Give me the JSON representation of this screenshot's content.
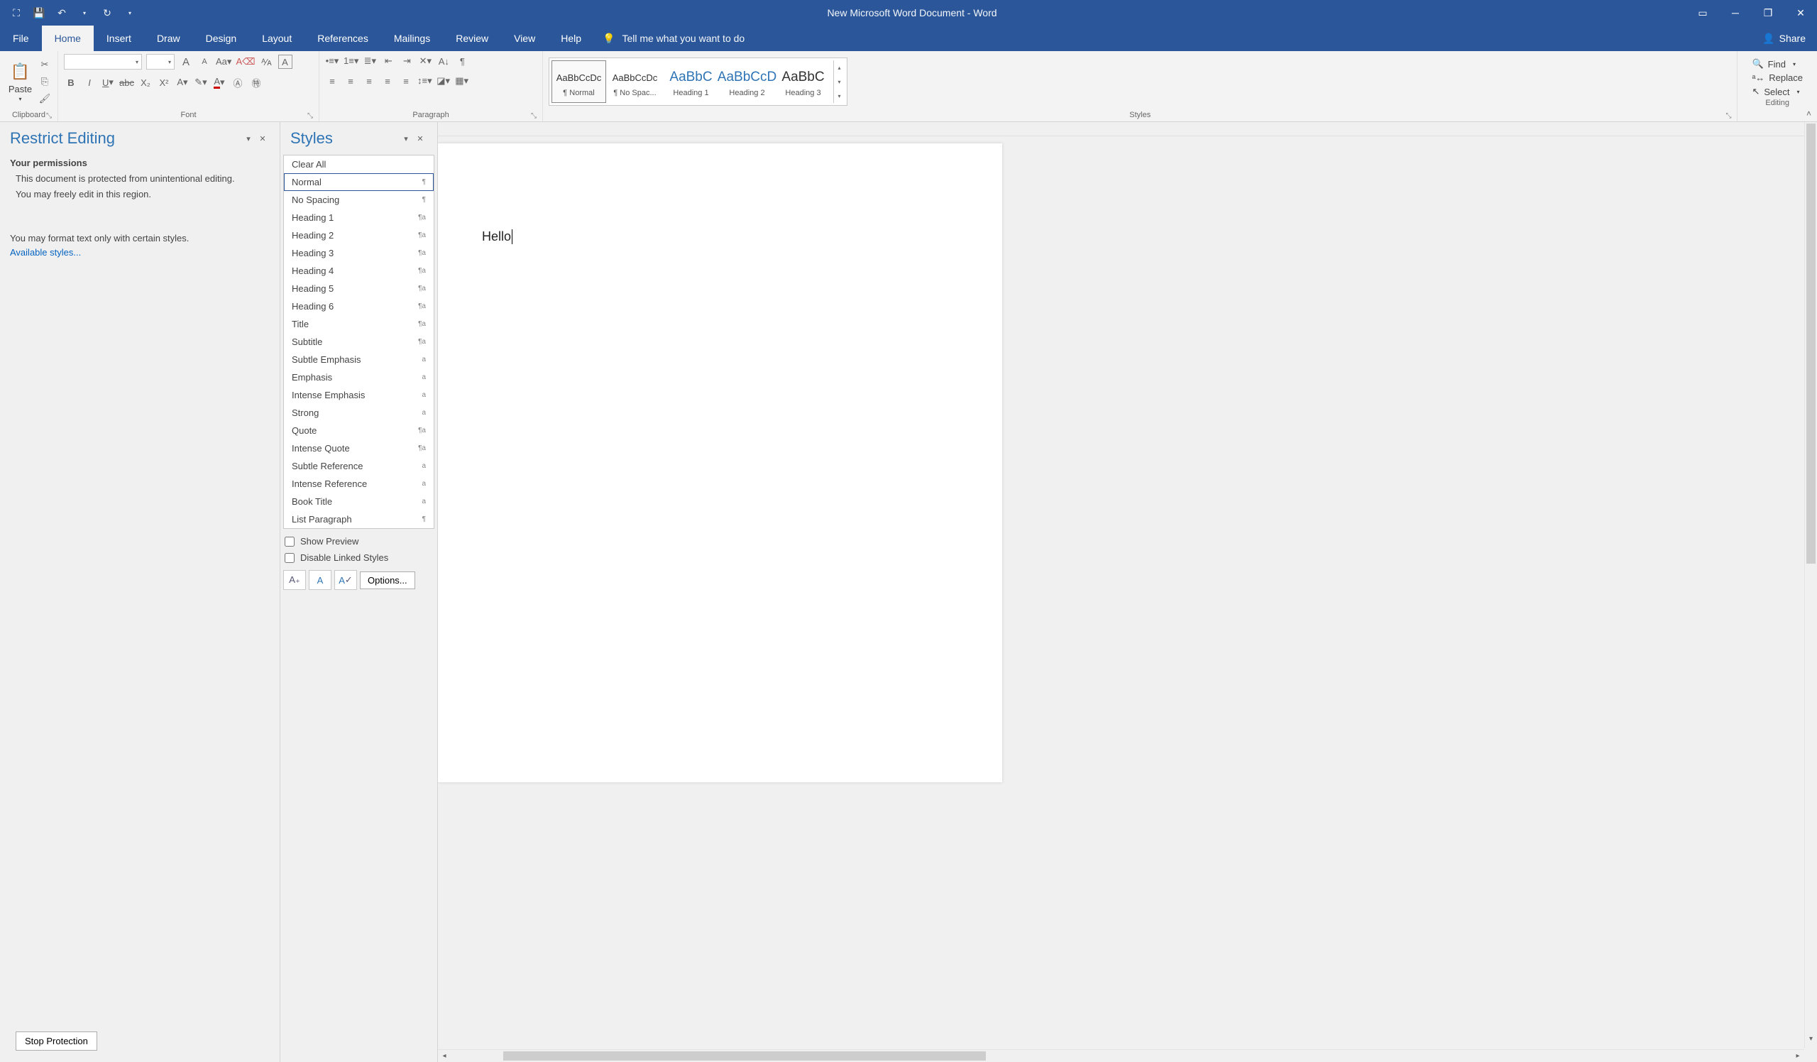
{
  "titlebar": {
    "title": "New Microsoft Word Document  -  Word"
  },
  "tabs": {
    "file": "File",
    "home": "Home",
    "insert": "Insert",
    "draw": "Draw",
    "design": "Design",
    "layout": "Layout",
    "references": "References",
    "mailings": "Mailings",
    "review": "Review",
    "view": "View",
    "help": "Help",
    "tellme": "Tell me what you want to do",
    "share": "Share"
  },
  "ribbon": {
    "clipboard": {
      "label": "Clipboard",
      "paste": "Paste"
    },
    "font": {
      "label": "Font"
    },
    "paragraph": {
      "label": "Paragraph"
    },
    "styles": {
      "label": "Styles",
      "items": [
        {
          "preview": "AaBbCcDc",
          "name": "¶ Normal",
          "selected": true,
          "blue": false
        },
        {
          "preview": "AaBbCcDc",
          "name": "¶ No Spac...",
          "selected": false,
          "blue": false
        },
        {
          "preview": "AaBbC",
          "name": "Heading 1",
          "selected": false,
          "blue": true
        },
        {
          "preview": "AaBbCcD",
          "name": "Heading 2",
          "selected": false,
          "blue": true
        },
        {
          "preview": "AaBbC",
          "name": "Heading 3",
          "selected": false,
          "blue": false
        }
      ]
    },
    "editing": {
      "label": "Editing",
      "find": "Find",
      "replace": "Replace",
      "select": "Select"
    }
  },
  "restrict_pane": {
    "title": "Restrict Editing",
    "permissions_heading": "Your permissions",
    "line1": "This document is protected from unintentional editing.",
    "line2": "You may freely edit in this region.",
    "line3": "You may format text only with certain styles.",
    "available_styles": "Available styles...",
    "stop_protection": "Stop Protection"
  },
  "styles_pane": {
    "title": "Styles",
    "items": [
      {
        "label": "Clear All",
        "glyph": ""
      },
      {
        "label": "Normal",
        "glyph": "¶",
        "selected": true
      },
      {
        "label": "No Spacing",
        "glyph": "¶"
      },
      {
        "label": "Heading 1",
        "glyph": "¶a"
      },
      {
        "label": "Heading 2",
        "glyph": "¶a"
      },
      {
        "label": "Heading 3",
        "glyph": "¶a"
      },
      {
        "label": "Heading 4",
        "glyph": "¶a"
      },
      {
        "label": "Heading 5",
        "glyph": "¶a"
      },
      {
        "label": "Heading 6",
        "glyph": "¶a"
      },
      {
        "label": "Title",
        "glyph": "¶a"
      },
      {
        "label": "Subtitle",
        "glyph": "¶a"
      },
      {
        "label": "Subtle Emphasis",
        "glyph": "a"
      },
      {
        "label": "Emphasis",
        "glyph": "a"
      },
      {
        "label": "Intense Emphasis",
        "glyph": "a"
      },
      {
        "label": "Strong",
        "glyph": "a"
      },
      {
        "label": "Quote",
        "glyph": "¶a"
      },
      {
        "label": "Intense Quote",
        "glyph": "¶a"
      },
      {
        "label": "Subtle Reference",
        "glyph": "a"
      },
      {
        "label": "Intense Reference",
        "glyph": "a"
      },
      {
        "label": "Book Title",
        "glyph": "a"
      },
      {
        "label": "List Paragraph",
        "glyph": "¶"
      }
    ],
    "show_preview": "Show Preview",
    "disable_linked": "Disable Linked Styles",
    "options": "Options..."
  },
  "document": {
    "text": "Hello"
  }
}
